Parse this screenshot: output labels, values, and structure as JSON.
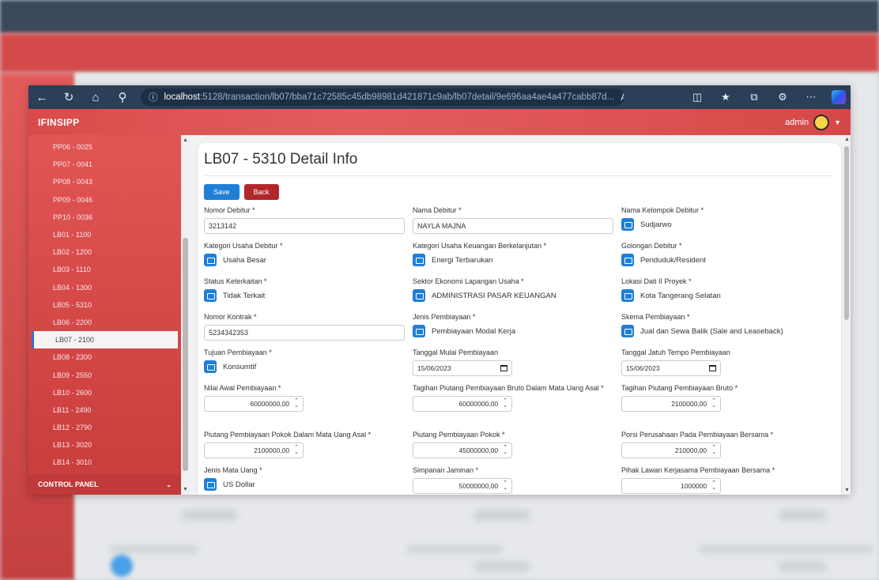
{
  "browser": {
    "url_host": "localhost",
    "url_path": ":5128/transaction/lb07/bba71c72585c45db98981d421871c9ab/lb07detail/9e696aa4ae4a477cabb87d..."
  },
  "app": {
    "brand": "IFINSIPP",
    "user": "admin"
  },
  "sidebar": {
    "items": [
      "PP06 - 0025",
      "PP07 - 0041",
      "PP08 - 0043",
      "PP09 - 0046",
      "PP10 - 0036",
      "LB01 - 1100",
      "LB02 - 1200",
      "LB03 - 1110",
      "LB04 - 1300",
      "LB05 - 5310",
      "LB06 - 2200",
      "LB07 - 2100",
      "LB08 - 2300",
      "LB09 - 2550",
      "LB10 - 2600",
      "LB11 - 2490",
      "LB12 - 2790",
      "LB13 - 3020",
      "LB14 - 3010"
    ],
    "active_index": 11,
    "control_panel": "CONTROL PANEL"
  },
  "page": {
    "title": "LB07 - 5310 Detail Info",
    "save": "Save",
    "back": "Back"
  },
  "fields": {
    "nomor_debitur": {
      "label": "Nomor Debitur *",
      "value": "3213142"
    },
    "nama_debitur": {
      "label": "Nama Debitur *",
      "value": "NAYLA MAJNA"
    },
    "nama_kelompok": {
      "label": "Nama Kelompok Debitur *",
      "value": "Sudjarwo"
    },
    "kategori_usaha": {
      "label": "Kategori Usaha Debitur *",
      "value": "Usaha Besar"
    },
    "kategori_keuangan": {
      "label": "Kategori Usaha Keuangan Berkelanjutan *",
      "value": "Energi Terbarukan"
    },
    "golongan": {
      "label": "Golongan Debitur *",
      "value": "Penduduk/Resident"
    },
    "status_keterkaitan": {
      "label": "Status Keterkaitan *",
      "value": "Tidak Terkait"
    },
    "sektor_ekonomi": {
      "label": "Sektor Ekonomi Lapangan Usaha *",
      "value": "ADMINISTRASI PASAR KEUANGAN"
    },
    "lokasi_dati": {
      "label": "Lokasi Dati II Proyek *",
      "value": "Kota Tangerang Selatan"
    },
    "nomor_kontrak": {
      "label": "Nomor Kontrak *",
      "value": "5234342353"
    },
    "jenis_pembiayaan": {
      "label": "Jenis Pembiayaan *",
      "value": "Pembiayaan Modal Kerja"
    },
    "skema_pembiayaan": {
      "label": "Skema Pembiayaan *",
      "value": "Jual dan Sewa Balik (Sale and Leaseback)"
    },
    "tujuan_pembiayaan": {
      "label": "Tujuan Pembiayaan *",
      "value": "Konsumtif"
    },
    "tanggal_mulai": {
      "label": "Tanggal Mulai Pembiayaan",
      "value": "15/06/2023"
    },
    "tanggal_jatuh_tempo": {
      "label": "Tanggal Jatuh Tempo Pembiayaan",
      "value": "15/06/2023"
    },
    "nilai_awal": {
      "label": "Nilai Awal Pembiayaan *",
      "value": "60000000,00"
    },
    "tagihan_bruto_asal": {
      "label": "Tagihan Piutang Pembiayaan Bruto Dalam Mata Uang Asal *",
      "value": "60000000,00"
    },
    "tagihan_bruto": {
      "label": "Tagihan Piutang Pembiayaan Bruto *",
      "value": "2100000,00"
    },
    "piutang_pokok_asal": {
      "label": "Piutang Pembiayaan Pokok Dalam Mata Uang Asal *",
      "value": "2100000,00"
    },
    "piutang_pokok": {
      "label": "Piutang Pembiayaan Pokok *",
      "value": "45000000,00"
    },
    "porsi_perusahaan": {
      "label": "Porsi Perusahaan Pada Pembiayaan Bersama *",
      "value": "210000,00"
    },
    "jenis_mata_uang": {
      "label": "Jenis Mata Uang *",
      "value": "US Dollar"
    },
    "simpanan_jaminan": {
      "label": "Simpanan Jaminan *",
      "value": "50000000,00"
    },
    "pihak_lawan": {
      "label": "Pihak Lawan Kerjasama Pembiayaan Bersama *",
      "value": "1000000"
    }
  }
}
